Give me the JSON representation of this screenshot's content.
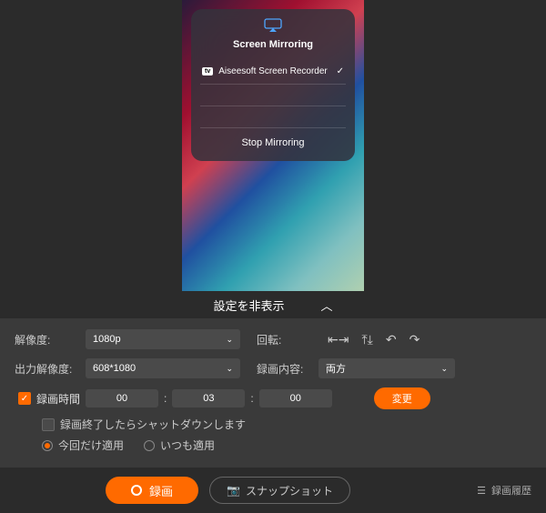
{
  "mirror": {
    "title": "Screen Mirroring",
    "device": "Aiseesoft Screen Recorder",
    "stop": "Stop Mirroring",
    "tv": "tv"
  },
  "toggle": {
    "label": "設定を非表示"
  },
  "settings": {
    "resolution_label": "解像度:",
    "resolution_value": "1080p",
    "output_label": "出力解像度:",
    "output_value": "608*1080",
    "rotation_label": "回転:",
    "content_label": "録画内容:",
    "content_value": "両方",
    "time_label": "録画時間",
    "hh": "00",
    "mm": "03",
    "ss": "00",
    "change": "変更",
    "shutdown": "録画終了したらシャットダウンします",
    "apply_once": "今回だけ適用",
    "apply_always": "いつも適用"
  },
  "bottom": {
    "record": "録画",
    "snapshot": "スナップショット",
    "history": "録画履歴"
  }
}
